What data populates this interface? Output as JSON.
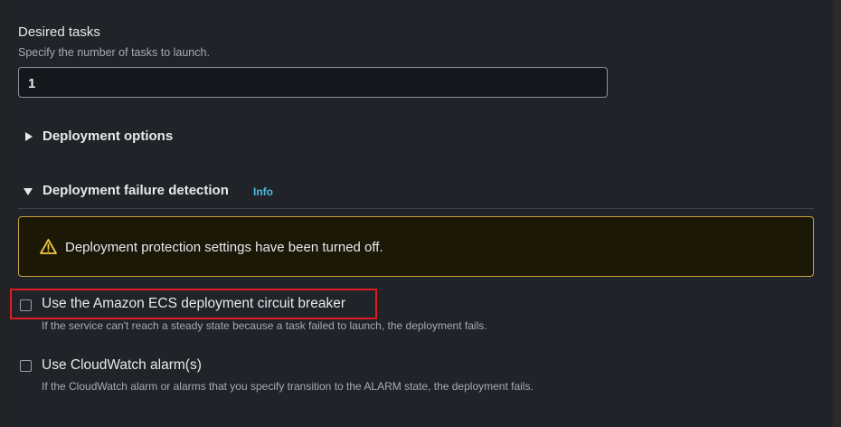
{
  "desired_tasks": {
    "title": "Desired tasks",
    "description": "Specify the number of tasks to launch.",
    "value": "1"
  },
  "deployment_options": {
    "label": "Deployment options",
    "expanded": false
  },
  "deployment_failure_detection": {
    "label": "Deployment failure detection",
    "info_link": "Info",
    "expanded": true,
    "alert": {
      "text": "Deployment protection settings have been turned off.",
      "icon": "warning-icon",
      "border_color": "#c9a23a"
    },
    "options": [
      {
        "label": "Use the Amazon ECS deployment circuit breaker",
        "description": "If the service can't reach a steady state because a task failed to launch, the deployment fails.",
        "checked": false,
        "highlighted": true
      },
      {
        "label": "Use CloudWatch alarm(s)",
        "description": "If the CloudWatch alarm or alarms that you specify transition to the ALARM state, the deployment fails.",
        "checked": false,
        "highlighted": false
      }
    ]
  },
  "colors": {
    "background": "#202328",
    "link": "#4fb9e0",
    "highlight": "#e01b24"
  }
}
